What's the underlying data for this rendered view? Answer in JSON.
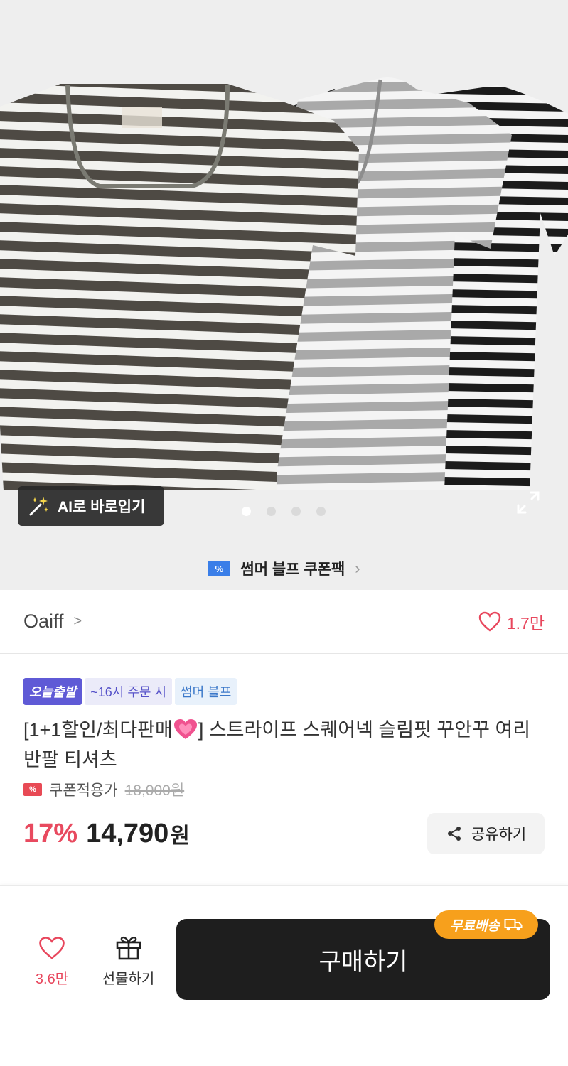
{
  "hero": {
    "ai_button_label": "AI로 바로입기",
    "carousel": {
      "total": 4,
      "active_index": 0
    },
    "coupon_pack_label": "썸머 블프 쿠폰팩"
  },
  "brand": {
    "name": "Oaiff",
    "likes": "1.7만"
  },
  "product": {
    "tags": [
      "오늘출발",
      "~16시 주문 시",
      "썸머 블프"
    ],
    "title_prefix": "[1+1할인/최다판매",
    "title_suffix": "] 스트라이프 스퀘어넥 슬림핏 꾸안꾸 여리 반팔 티셔츠",
    "coupon_label": "쿠폰적용가",
    "original_price": "18,000원",
    "discount": "17%",
    "price": "14,790",
    "currency": "원",
    "share_label": "공유하기"
  },
  "bottom_bar": {
    "like_count": "3.6만",
    "gift_label": "선물하기",
    "buy_label": "구매하기",
    "shipping_badge": "무료배송"
  },
  "colors": {
    "accent_red": "#e8475d",
    "buy_button": "#1e1e1e",
    "shipping_badge": "#f7a01c",
    "tag_purple": "#5f5ad6",
    "coupon_blue": "#3a7ee8"
  }
}
